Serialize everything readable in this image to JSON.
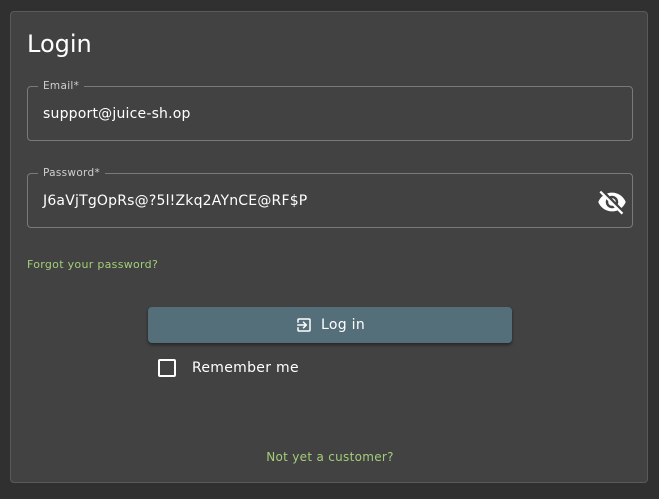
{
  "login": {
    "title": "Login",
    "email": {
      "label": "Email*",
      "value": "support@juice-sh.op"
    },
    "password": {
      "label": "Password*",
      "value": "J6aVjTgOpRs@?5l!Zkq2AYnCE@RF$P",
      "toggle_icon": "visibility-off-icon"
    },
    "forgot_password": "Forgot your password?",
    "login_button": {
      "label": "Log in",
      "icon": "login-icon"
    },
    "remember_me": {
      "label": "Remember me",
      "checked": false
    },
    "register_link": "Not yet a customer?"
  },
  "colors": {
    "background": "#303030",
    "card": "#424242",
    "primary_button": "#546e7a",
    "link": "#a3cd7a"
  }
}
